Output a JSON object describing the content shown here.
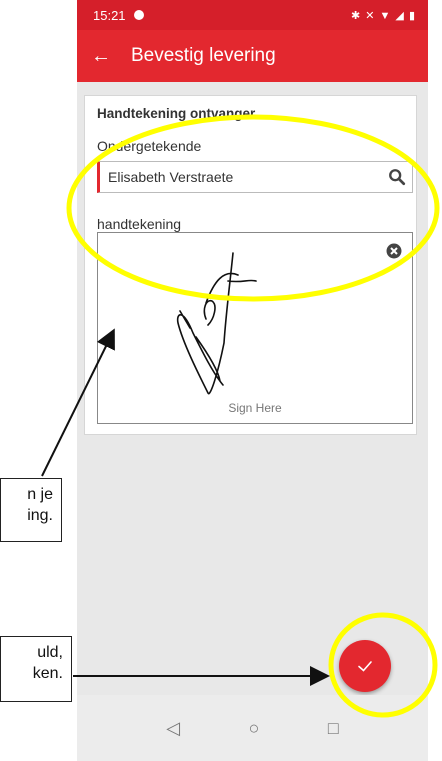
{
  "status_bar": {
    "time": "15:21",
    "icons": "✱ ✕ ▼ ◢ ▮"
  },
  "app_bar": {
    "back_icon": "←",
    "title": "Bevestig levering"
  },
  "card": {
    "section_title": "Handtekening ontvanger",
    "signer_label": "Ondergetekende",
    "signer_value": "Elisabeth Verstraete",
    "signature_label": "handtekening",
    "sign_here": "Sign Here"
  },
  "fab": {
    "icon": "check-icon"
  },
  "nav_bar": {
    "back": "◁",
    "home": "○",
    "recents": "□"
  },
  "callouts": [
    {
      "lines": [
        "n je",
        "ing."
      ]
    },
    {
      "lines": [
        "uld,",
        "ken."
      ]
    }
  ],
  "colors": {
    "brand_red": "#e3282f",
    "status_red": "#d51f2a",
    "highlight": "#ffff00"
  }
}
